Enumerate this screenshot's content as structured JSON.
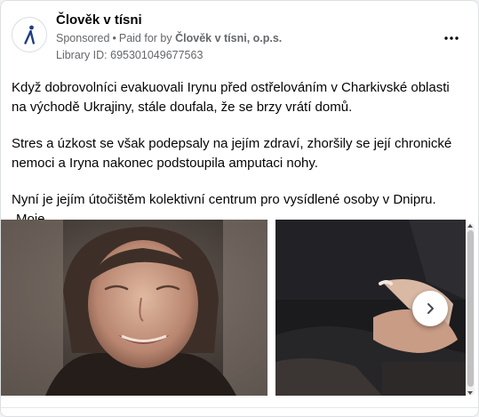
{
  "post": {
    "page_name": "Člověk v tísni",
    "sponsored_label": "Sponsored",
    "separator": "•",
    "paid_for_prefix": "Paid for by",
    "paid_for_entity": "Člověk v tísni, o.p.s.",
    "library_id": "Library ID: 695301049677563",
    "more_icon": "more-horizontal-icon",
    "body": [
      "Když dobrovolníci evakuovali Irynu před ostřelováním v Charkivské oblasti na východě Ukrajiny, stále doufala, že se brzy vrátí domů.",
      "Stres a úzkost se však podepsaly na jejím zdraví, zhoršily se její chronické nemoci a Iryna nakonec podstoupila amputaci nohy.",
      "Nyní je jejím útočištěm kolektivní centrum pro vysídlené osoby v Dnipru. „Moje…"
    ]
  },
  "carousel": {
    "next_icon": "chevron-right-icon",
    "slides": [
      {
        "subject": "smiling elderly woman portrait"
      },
      {
        "subject": "hands holding hand"
      }
    ]
  },
  "colors": {
    "brand_blue": "#1f3c88",
    "text_primary": "#050505",
    "text_secondary": "#65676b",
    "border": "#dddfe2"
  }
}
